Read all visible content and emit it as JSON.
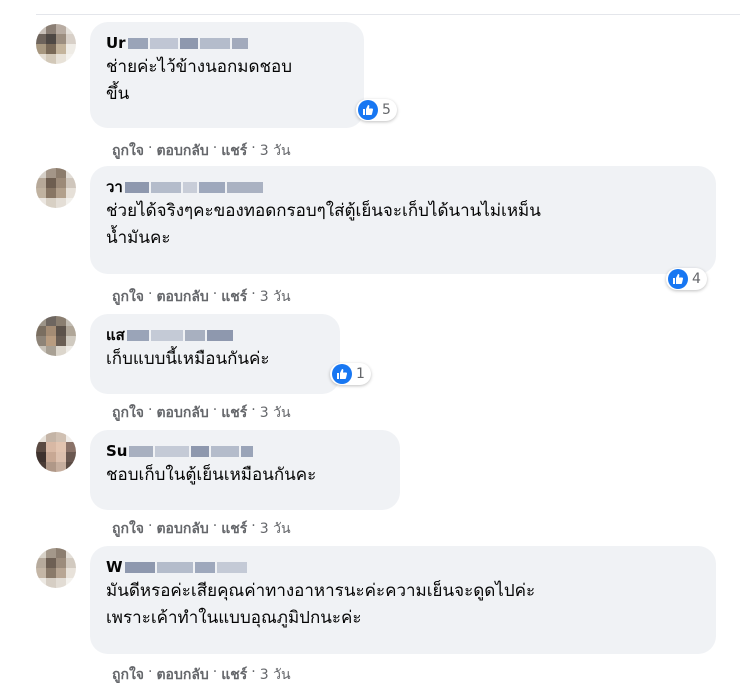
{
  "comments": [
    {
      "name_visible": "Ur",
      "text": "ช่ายค่ะไว้ข้างนอกมดชอบ\nขึ้น",
      "reactions": "5",
      "like": "ถูกใจ",
      "reply": "ตอบกลับ",
      "share": "แชร์",
      "time": "3 วัน"
    },
    {
      "name_visible": "วา",
      "text": "ช่วยได้จริงๆคะของทอดกรอบๆใส่ตู้เย็นจะเก็บได้นานไม่เหม็น\nน้ำมันคะ",
      "reactions": "4",
      "like": "ถูกใจ",
      "reply": "ตอบกลับ",
      "share": "แชร์",
      "time": "3 วัน"
    },
    {
      "name_visible": "แส",
      "text": "เก็บแบบนี้เหมือนกันค่ะ",
      "reactions": "1",
      "like": "ถูกใจ",
      "reply": "ตอบกลับ",
      "share": "แชร์",
      "time": "3 วัน"
    },
    {
      "name_visible": "Su",
      "text": "ชอบเก็บในตู้เย็นเหมือนกันคะ",
      "reactions": "",
      "like": "ถูกใจ",
      "reply": "ตอบกลับ",
      "share": "แชร์",
      "time": "3 วัน"
    },
    {
      "name_visible": "W",
      "text": "มันดีหรอค่ะเสียคุณค่าทางอาหารนะค่ะความเย็นจะดูดไปค่ะ\nเพราะเค้าทำในแบบอุณภูมิปกนะค่ะ",
      "reactions": "",
      "like": "ถูกใจ",
      "reply": "ตอบกลับ",
      "share": "แชร์",
      "time": "3 วัน"
    }
  ],
  "icons": {
    "like_reaction": "thumbs-up-icon",
    "avatar": "pixelated-avatar"
  },
  "colors": {
    "bubble": "#f0f2f5",
    "like_blue": "#1877f2",
    "meta_gray": "#65676b",
    "text": "#050505"
  }
}
